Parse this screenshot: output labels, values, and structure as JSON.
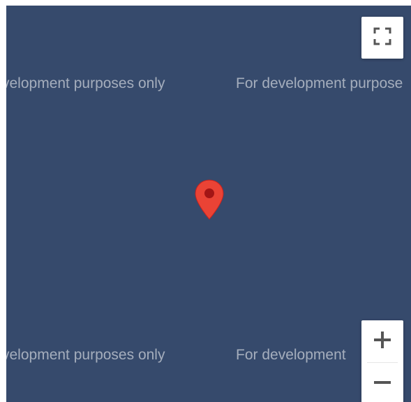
{
  "map": {
    "background_color": "#364a6c",
    "watermarks": [
      "velopment purposes only",
      "For development purpose",
      "velopment purposes only",
      "For development"
    ],
    "marker": {
      "icon": "map-pin-icon",
      "color": "#ea4335"
    }
  },
  "controls": {
    "fullscreen": {
      "icon": "fullscreen-icon"
    },
    "zoom_in": {
      "icon": "plus-icon"
    },
    "zoom_out": {
      "icon": "minus-icon"
    }
  }
}
